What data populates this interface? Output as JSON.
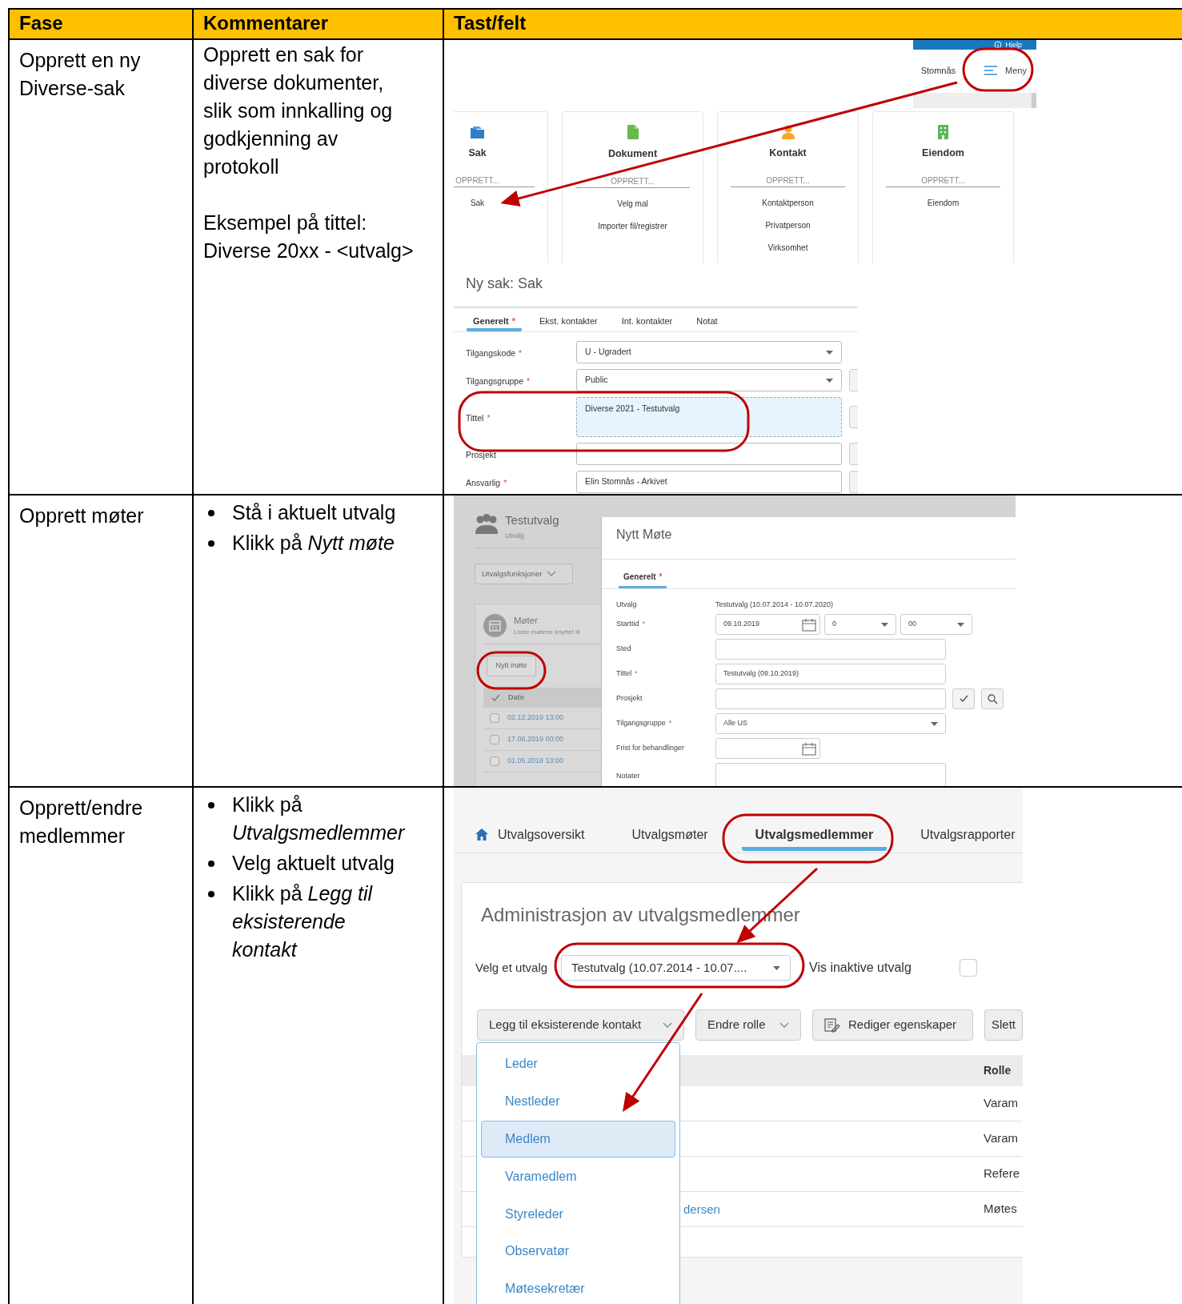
{
  "table": {
    "columns": [
      "Fase",
      "Kommentarer",
      "Tast/felt"
    ],
    "rows": [
      {
        "phase": "Opprett en ny Diverse-sak",
        "comments": [
          {
            "kind": "paragraph",
            "text": "Opprett en sak for diverse dokumenter, slik som innkalling og godkjenning av protokoll"
          },
          {
            "kind": "paragraph",
            "text": "Eksempel på tittel:\nDiverse 20xx - <utvalg>"
          }
        ],
        "screenshot": {
          "kind": "new-case",
          "help_label": "Hjelp",
          "user_name": "Stomnås",
          "menu_label": "Meny",
          "cards": [
            {
              "title": "Sak",
              "section": "OPPRETT...",
              "items": [
                "Sak"
              ]
            },
            {
              "title": "Dokument",
              "section": "OPPRETT...",
              "items": [
                "Velg mal",
                "Importer fil/registrer"
              ]
            },
            {
              "title": "Kontakt",
              "section": "OPPRETT...",
              "items": [
                "Kontaktperson",
                "Privatperson",
                "Virksomhet"
              ]
            },
            {
              "title": "Eiendom",
              "section": "OPPRETT...",
              "items": [
                "Eiendom"
              ]
            }
          ],
          "form": {
            "title": "Ny sak: Sak",
            "tabs": [
              {
                "label": "Generelt",
                "mark": "*",
                "selected": true
              },
              {
                "label": "Ekst. kontakter",
                "selected": false
              },
              {
                "label": "Int. kontakter",
                "selected": false
              },
              {
                "label": "Notat",
                "selected": false
              }
            ],
            "fields": [
              {
                "label": "Tilgangskode",
                "mark": "*",
                "kind": "select",
                "value": "U - Ugradert",
                "focused": false,
                "side_button": false
              },
              {
                "label": "Tilgangsgruppe",
                "mark": "*",
                "kind": "select",
                "value": "Public",
                "focused": false,
                "side_button": true
              },
              {
                "label": "Tittel",
                "mark": "*",
                "kind": "textarea",
                "value": "Diverse 2021 - Testutvalg",
                "focused": true,
                "side_button": true
              },
              {
                "label": "Prosjekt",
                "kind": "input",
                "focused": false,
                "side_button": true
              },
              {
                "label": "Ansvarlig",
                "mark": "*",
                "kind": "input",
                "value": "Elin Stomnås - Arkivet",
                "focused": false,
                "side_button": true
              }
            ]
          }
        }
      },
      {
        "phase": "Opprett møter",
        "comments": [
          {
            "kind": "bullet",
            "text": "Stå i aktuelt utvalg"
          },
          {
            "kind": "bullet",
            "text": "Klikk på *Nytt møte*"
          }
        ],
        "screenshot": {
          "kind": "new-meeting",
          "committee": {
            "title": "Testutvalg",
            "subtitle": "Utvalg"
          },
          "functions_button": "Utvalgsfunksjoner",
          "meetings": {
            "title": "Møter",
            "description": "Lister møtene knyttet til",
            "new_button": "Nytt møte",
            "column": "Dato",
            "rows": [
              {
                "date": "02.12.2019 13:00",
                "checked": false
              },
              {
                "date": "17.06.2019 00:00",
                "checked": false
              },
              {
                "date": "01.05.2018 13:00",
                "checked": false
              }
            ]
          },
          "dialog": {
            "title": "Nytt Møte",
            "tabs": [
              {
                "label": "Generelt",
                "mark": "*",
                "selected": true
              }
            ],
            "fields": [
              {
                "label": "Utvalg",
                "kind": "text",
                "value": "Testutvalg (10.07.2014 - 10.07.2020)"
              },
              {
                "label": "Starttid",
                "mark": "*",
                "kind": "datetime",
                "value": "09.10.2019",
                "hour": "0",
                "minute": "00"
              },
              {
                "label": "Sted",
                "kind": "input"
              },
              {
                "label": "Tittel",
                "mark": "*",
                "kind": "input",
                "value": "Testutvalg (09.10.2019)"
              },
              {
                "label": "Prosjekt",
                "kind": "lookup"
              },
              {
                "label": "Tilgangsgruppe",
                "mark": "*",
                "kind": "select",
                "value": "Alle US"
              },
              {
                "label": "Frist for behandlinger",
                "kind": "date"
              },
              {
                "label": "Notater",
                "kind": "textarea"
              }
            ]
          }
        }
      },
      {
        "phase": "Opprett/endre medlemmer",
        "comments": [
          {
            "kind": "bullet",
            "text": "Klikk på *Utvalgsmedlemmer*"
          },
          {
            "kind": "bullet",
            "text": "Velg aktuelt utvalg"
          },
          {
            "kind": "bullet",
            "text": "Klikk på *Legg til eksisterende kontakt*"
          }
        ],
        "screenshot": {
          "kind": "committee-members",
          "nav": [
            {
              "label": "Utvalgsoversikt",
              "selected": false
            },
            {
              "label": "Utvalgsmøter",
              "selected": false
            },
            {
              "label": "Utvalgsmedlemmer",
              "selected": true
            },
            {
              "label": "Utvalgsrapporter",
              "selected": false
            }
          ],
          "panel": {
            "title": "Administrasjon av utvalgsmedlemmer",
            "select_label": "Velg et utvalg",
            "select_value": "Testutvalg (10.07.2014 - 10.07....",
            "inactive_label": "Vis inaktive utvalg",
            "inactive_checked": false,
            "buttons": [
              {
                "label": "Legg til eksisterende kontakt",
                "kind": "dropdown"
              },
              {
                "label": "Endre rolle",
                "kind": "dropdown"
              },
              {
                "label": "Rediger egenskaper",
                "kind": "edit"
              },
              {
                "label": "Slett",
                "kind": "plain"
              }
            ],
            "role_column": "Rolle",
            "rows": [
              {
                "role": "Varam"
              },
              {
                "role": "Varam"
              },
              {
                "role": "Refere"
              },
              {
                "name": "dersen",
                "role": "Møtes"
              }
            ],
            "menu": [
              {
                "label": "Leder",
                "selected": false
              },
              {
                "label": "Nestleder",
                "selected": false
              },
              {
                "label": "Medlem",
                "selected": true
              },
              {
                "label": "Varamedlem",
                "selected": false
              },
              {
                "label": "Styreleder",
                "selected": false
              },
              {
                "label": "Observatør",
                "selected": false
              },
              {
                "label": "Møtesekretær",
                "selected": false
              }
            ]
          }
        }
      }
    ]
  }
}
